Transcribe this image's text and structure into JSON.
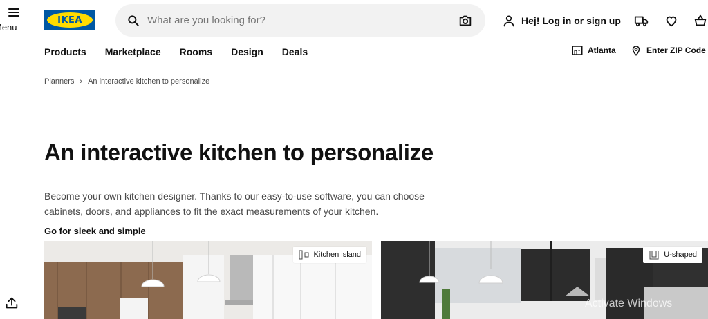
{
  "header": {
    "menu_label": "Menu",
    "logo_text": "IKEA",
    "search_placeholder": "What are you looking for?",
    "login_label": "Hej! Log in or sign up"
  },
  "nav": {
    "items": [
      "Products",
      "Marketplace",
      "Rooms",
      "Design",
      "Deals"
    ],
    "store": "Atlanta",
    "zip": "Enter ZIP Code"
  },
  "breadcrumb": {
    "parent": "Planners",
    "separator": "›",
    "current": "An interactive kitchen to personalize"
  },
  "page": {
    "title": "An interactive kitchen to personalize",
    "intro": "Become your own kitchen designer. Thanks to our easy-to-use software, you can choose cabinets, doors, and appliances to fit the exact measurements of your kitchen.",
    "subheading": "Go for sleek and simple"
  },
  "cards": [
    {
      "tag": "Kitchen island"
    },
    {
      "tag": "U-shaped"
    }
  ],
  "watermark": "Activate Windows",
  "colors": {
    "brand_blue": "#0058a3",
    "brand_yellow": "#ffdb00",
    "text": "#111111",
    "muted": "#484848",
    "search_bg": "#f2f2f2"
  },
  "icons": [
    "hamburger-icon",
    "search-icon",
    "camera-icon",
    "person-icon",
    "truck-icon",
    "heart-icon",
    "basket-icon",
    "store-icon",
    "location-pin-icon",
    "share-icon"
  ]
}
